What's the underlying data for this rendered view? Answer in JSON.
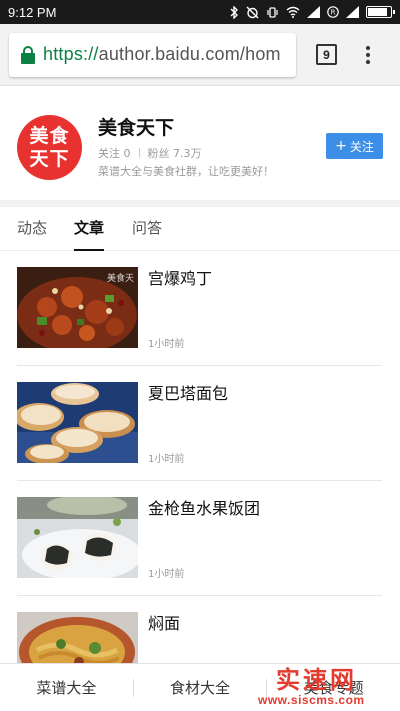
{
  "status_bar": {
    "time": "9:12 PM",
    "battery_level": 0.9
  },
  "browser": {
    "url_scheme": "https://",
    "url_rest": "author.baidu.com/hom",
    "tab_count": "9"
  },
  "profile": {
    "avatar_text": "美食天下",
    "name": "美食天下",
    "following_label": "关注 0",
    "followers_label": "粉丝 7.3万",
    "description": "菜谱大全与美食社群，让吃更美好！",
    "follow_plus": "+",
    "follow_label": "关注",
    "accent_color": "#3c8ee6",
    "avatar_color": "#e8322f"
  },
  "tabs": [
    {
      "label": "动态"
    },
    {
      "label": "文章",
      "active": true
    },
    {
      "label": "问答"
    }
  ],
  "articles": [
    {
      "title": "宫爆鸡丁",
      "time": "1小时前",
      "thumb_overlay": "美食天"
    },
    {
      "title": "夏巴塔面包",
      "time": "1小时前"
    },
    {
      "title": "金枪鱼水果饭团",
      "time": "1小时前"
    },
    {
      "title": "焖面",
      "time": ""
    }
  ],
  "bottom_nav": [
    {
      "label": "菜谱大全"
    },
    {
      "label": "食材大全"
    },
    {
      "label": "美食专题"
    }
  ],
  "watermark": {
    "main": "实速网",
    "url": "www.siscms.com"
  }
}
